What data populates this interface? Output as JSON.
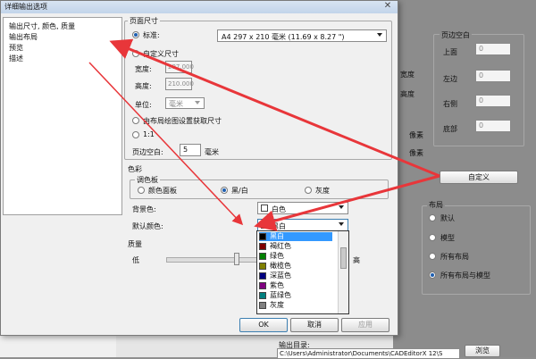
{
  "dialog": {
    "title": "详细输出选项",
    "list_items": [
      "输出尺寸, 颜色, 质量",
      "输出布局",
      "预览",
      "描述"
    ]
  },
  "page_size": {
    "group_label": "页面尺寸",
    "standard_label": "标准:",
    "standard_value": "A4 297 x 210 毫米 (11.69 x 8.27 \")",
    "custom_label": "自定义尺寸",
    "width_label": "宽度:",
    "width_value": "297.000",
    "height_label": "高度:",
    "height_value": "210.000",
    "unit_label": "单位:",
    "unit_value": "毫米",
    "from_layout_label": "由布局绘图设置获取尺寸",
    "one_to_one_label": "1:1",
    "margin_label": "页边空白:",
    "margin_value": "5",
    "margin_unit": "毫米"
  },
  "color": {
    "group_label": "色彩",
    "palette_label": "调色板",
    "options": [
      "颜色面板",
      "黑/白",
      "灰度"
    ],
    "bg_color_label": "背景色:",
    "bg_color_value": "白色",
    "default_color_label": "默认颜色:",
    "default_color_value": "黑白",
    "dropdown_options": [
      {
        "label": "黑白",
        "swatch": "#000000",
        "selected": true
      },
      {
        "label": "褐红色",
        "swatch": "#800000",
        "selected": false
      },
      {
        "label": "绿色",
        "swatch": "#008000",
        "selected": false
      },
      {
        "label": "橄榄色",
        "swatch": "#808000",
        "selected": false
      },
      {
        "label": "深蓝色",
        "swatch": "#000080",
        "selected": false
      },
      {
        "label": "紫色",
        "swatch": "#800080",
        "selected": false
      },
      {
        "label": "蓝绿色",
        "swatch": "#008080",
        "selected": false
      },
      {
        "label": "灰度",
        "swatch": "#808080",
        "selected": false
      }
    ]
  },
  "quality": {
    "group_label": "质量",
    "low_label": "低",
    "high_label": "高"
  },
  "buttons": {
    "ok": "OK",
    "cancel": "取消",
    "apply": "应用"
  },
  "background_window": {
    "margin_group_label": "页边空白",
    "top_label": "上面",
    "left_label": "左边",
    "right_label": "右侧",
    "bottom_label": "底部",
    "margin_top_value": "0",
    "margin_left_value": "0",
    "margin_right_value": "0",
    "margin_bottom_value": "0",
    "custom_button": "自定义",
    "layout_group_label": "布局",
    "layout_options": [
      "默认",
      "模型",
      "所有布局",
      "所有布局与模型"
    ],
    "output_dir_label": "输出目录:",
    "output_dir_value": "C:\\Users\\Administrator\\Documents\\CADEditorX 12\\S",
    "browse_button": "浏览",
    "partial_labels": [
      "宽度",
      "高度",
      "像素",
      "像素"
    ]
  },
  "accent_colors": {
    "annotation_arrow": "#e8363a",
    "selection": "#3399ff"
  }
}
